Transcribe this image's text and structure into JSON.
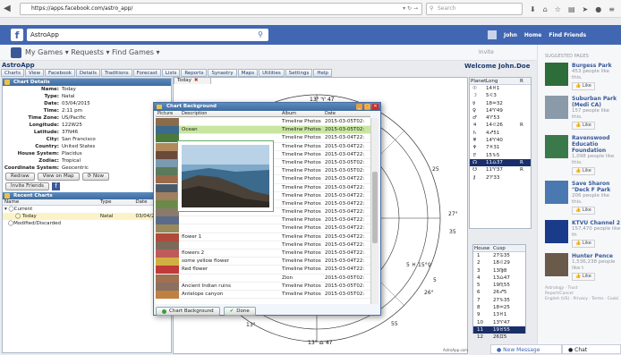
{
  "browser": {
    "url": "https://apps.facebook.com/astro_app/",
    "search_placeholder": "Search"
  },
  "facebook": {
    "app_label": "AstroApp",
    "user": "John",
    "home": "Home",
    "find_friends": "Find Friends"
  },
  "appnav": {
    "text": "My Games ▾   Requests ▾   Find Games ▾",
    "invite": "Invite"
  },
  "app": {
    "name": "AstroApp",
    "welcome": "Welcome John.Doe"
  },
  "menu": [
    "Charts",
    "View",
    "Facebook",
    "Details",
    "Traditions",
    "Forecast",
    "Lists",
    "Reports",
    "Synastry",
    "Maps",
    "Utilities",
    "Settings",
    "Help"
  ],
  "chart_details": {
    "title": "Chart Details",
    "rows": [
      {
        "k": "Name:",
        "v": "Today"
      },
      {
        "k": "Type:",
        "v": "Natal"
      },
      {
        "k": "Date:",
        "v": "03/04/2015"
      },
      {
        "k": "Time:",
        "v": "2:11 pm"
      },
      {
        "k": "Time Zone:",
        "v": "US/Pacific"
      },
      {
        "k": "Longitude:",
        "v": "122W25"
      },
      {
        "k": "Latitude:",
        "v": "37N46"
      },
      {
        "k": "City:",
        "v": "San Francisco"
      },
      {
        "k": "Country:",
        "v": "United States"
      },
      {
        "k": "House System:",
        "v": "Placidus"
      },
      {
        "k": "Zodiac:",
        "v": "Tropical"
      },
      {
        "k": "Coordinate System:",
        "v": "Geocentric"
      }
    ],
    "redraw": "Redraw",
    "view_map": "View on Map",
    "now": "Now",
    "invite_friends": "Invite Friends"
  },
  "recent": {
    "title": "Recent Charts",
    "cols": [
      "Name",
      "Type",
      "Date"
    ],
    "current": "Current",
    "today": {
      "name": "Today",
      "type": "Natal",
      "date": "03/04/2015"
    },
    "modified": "Modified/Discarded"
  },
  "tab": {
    "label": "Today"
  },
  "wheel": {
    "top": "13° ♈ 47",
    "bottom": "13° ♎ 47",
    "right_a": "27°",
    "right_b": "35",
    "right_c": "26°",
    "right_d": "5",
    "right_e": "25",
    "right_f": "55",
    "left_a": "13°",
    "left_b": "5 ♓ 15°♀"
  },
  "planets": {
    "cols": [
      "Planet",
      "Long",
      "R"
    ],
    "rows": [
      {
        "p": "☉",
        "l": "14♓1",
        "r": ""
      },
      {
        "p": "☽",
        "l": "5♌3",
        "r": ""
      },
      {
        "p": "☿",
        "l": "18♒32",
        "r": ""
      },
      {
        "p": "♀",
        "l": "14♈49",
        "r": ""
      },
      {
        "p": "♂",
        "l": "4♈53",
        "r": ""
      },
      {
        "p": "♃",
        "l": "14♌26",
        "r": "R"
      },
      {
        "p": "♄",
        "l": "4♐51",
        "r": ""
      },
      {
        "p": "♅",
        "l": "14♈40",
        "r": ""
      },
      {
        "p": "♆",
        "l": "7♓31",
        "r": ""
      },
      {
        "p": "♇",
        "l": "15♑5",
        "r": ""
      },
      {
        "p": "☊",
        "l": "11♎37",
        "r": "R"
      },
      {
        "p": "☋",
        "l": "11♈37",
        "r": "R"
      },
      {
        "p": "⚷",
        "l": "2♈33",
        "r": ""
      }
    ],
    "selected": 10
  },
  "houses": {
    "cols": [
      "House",
      "Cusp"
    ],
    "rows": [
      {
        "h": "1",
        "c": "27♋35"
      },
      {
        "h": "2",
        "c": "18♌29"
      },
      {
        "h": "3",
        "c": "13♍8"
      },
      {
        "h": "4",
        "c": "13♎47"
      },
      {
        "h": "5",
        "c": "19♏55"
      },
      {
        "h": "6",
        "c": "26♐5"
      },
      {
        "h": "7",
        "c": "27♑35"
      },
      {
        "h": "8",
        "c": "18♒25"
      },
      {
        "h": "9",
        "c": "13♓1"
      },
      {
        "h": "10",
        "c": "13♈47"
      },
      {
        "h": "11",
        "c": "19♉55"
      },
      {
        "h": "12",
        "c": "26♊5"
      }
    ],
    "selected": 10
  },
  "dialog": {
    "title": "Chart Background",
    "cols": [
      "Picture",
      "Description",
      "Album",
      "Date"
    ],
    "rows": [
      {
        "d": "",
        "a": "Timeline Photos",
        "t": "2015-03-05T02:"
      },
      {
        "d": "Ocean",
        "a": "Timeline Photos",
        "t": "2015-03-05T02:"
      },
      {
        "d": "",
        "a": "Timeline Photos",
        "t": "2015-03-04T22:"
      },
      {
        "d": "",
        "a": "Timeline Photos",
        "t": "2015-03-04T22:"
      },
      {
        "d": "",
        "a": "Timeline Photos",
        "t": "2015-03-04T22:"
      },
      {
        "d": "",
        "a": "Timeline Photos",
        "t": "2015-03-05T02:"
      },
      {
        "d": "",
        "a": "Timeline Photos",
        "t": "2015-03-05T02:"
      },
      {
        "d": "",
        "a": "Timeline Photos",
        "t": "2015-03-04T22:"
      },
      {
        "d": "",
        "a": "Timeline Photos",
        "t": "2015-03-04T22:"
      },
      {
        "d": "",
        "a": "Timeline Photos",
        "t": "2015-03-04T22:"
      },
      {
        "d": "",
        "a": "Timeline Photos",
        "t": "2015-03-04T22:"
      },
      {
        "d": "",
        "a": "Timeline Photos",
        "t": "2015-03-04T22:"
      },
      {
        "d": "",
        "a": "Timeline Photos",
        "t": "2015-03-04T22:"
      },
      {
        "d": "",
        "a": "Timeline Photos",
        "t": "2015-03-04T22:"
      },
      {
        "d": "flower 1",
        "a": "Timeline Photos",
        "t": "2015-03-04T22:"
      },
      {
        "d": "",
        "a": "Timeline Photos",
        "t": "2015-03-04T22:"
      },
      {
        "d": "flowers 2",
        "a": "Timeline Photos",
        "t": "2015-03-04T22:"
      },
      {
        "d": "some yellow flower",
        "a": "Timeline Photos",
        "t": "2015-03-04T22:"
      },
      {
        "d": "Red flower",
        "a": "Timeline Photos",
        "t": "2015-03-04T22:"
      },
      {
        "d": "",
        "a": "Zion",
        "t": "2015-03-05T02:"
      },
      {
        "d": "Ancient Indian ruins",
        "a": "Timeline Photos",
        "t": "2015-03-05T02:"
      },
      {
        "d": "Antelope canyon",
        "a": "Timeline Photos",
        "t": "2015-03-05T02:"
      }
    ],
    "selected": 1,
    "footer_label": "Chart Background",
    "done": "Done"
  },
  "fbright": {
    "header": "SUGGESTED PAGES",
    "pages": [
      {
        "t": "Burgess Park",
        "s": "453 people like this.",
        "like": "Like"
      },
      {
        "t": "Suburban Park (Medi CA)",
        "s": "157 people like this.",
        "like": "Like"
      },
      {
        "t": "Ravenswood Educatio Foundation",
        "s": "1,098 people like this.",
        "like": "Like"
      },
      {
        "t": "Save Sharon \"Deck F Park",
        "s": "206 people like this.",
        "like": "Like"
      },
      {
        "t": "KTVU Channel 2",
        "s": "157,470 people like th",
        "like": "Like"
      },
      {
        "t": "Hunter Pence",
        "s": "1,536,238 people like t",
        "like": "Like"
      }
    ],
    "footer1": "Astrology · Trust",
    "footer2": "Report/Cancel",
    "footer3": "English (US) · Privacy · Terms · Cooki"
  },
  "bottom": {
    "new_message": "● New Message",
    "chat": "● Chat"
  },
  "colors": {
    "fb_blue": "#4267b2",
    "panel_head": "#3e6b9f",
    "selected": "#1a2f6a"
  }
}
